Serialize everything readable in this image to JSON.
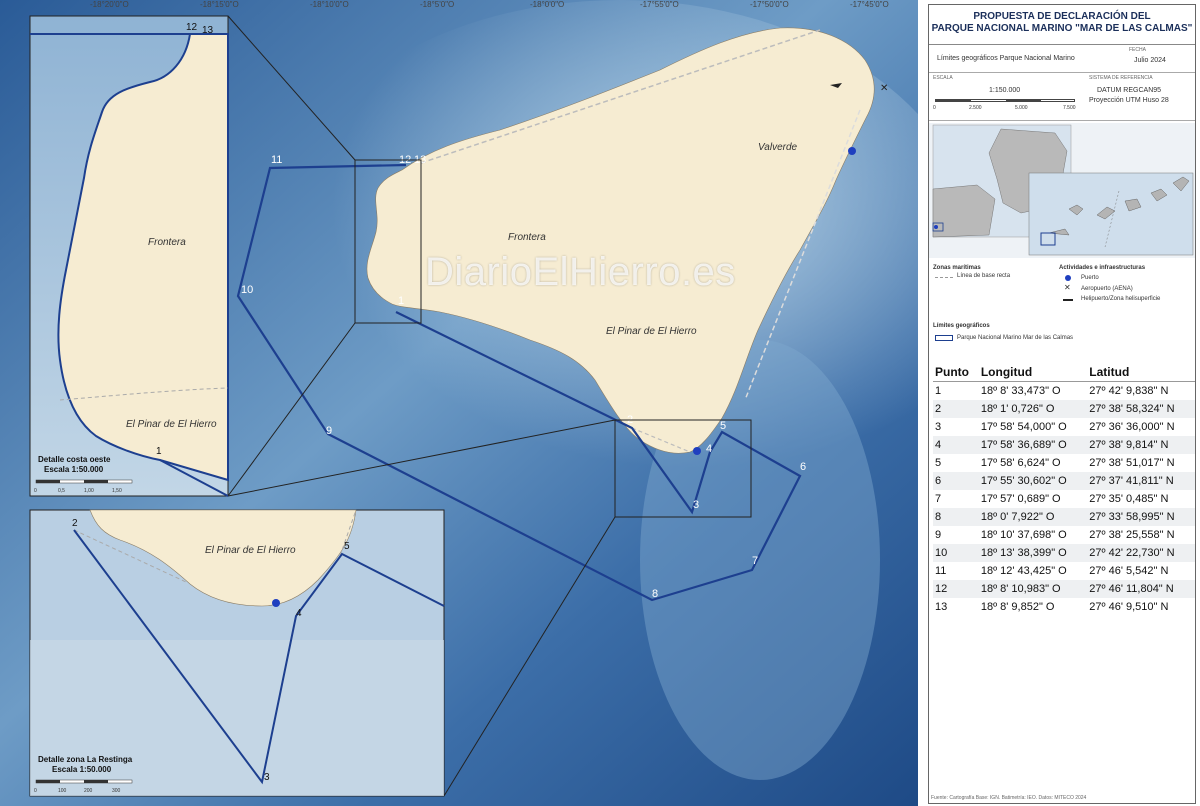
{
  "map": {
    "places": {
      "valverde": "Valverde",
      "frontera": "Frontera",
      "el_pinar": "El Pinar de El Hierro"
    },
    "points": [
      "1",
      "2",
      "3",
      "4",
      "5",
      "6",
      "7",
      "8",
      "9",
      "10",
      "11",
      "12",
      "13"
    ],
    "inset_left": {
      "place_frontera": "Frontera",
      "place_el_pinar": "El Pinar de El Hierro",
      "caption_line1": "Detalle costa oeste",
      "caption_line2": "Escala 1:50.000",
      "scale_labels": [
        "0",
        "0,5",
        "1,00",
        "1,50"
      ]
    },
    "inset_bottom": {
      "place_el_pinar": "El Pinar de El Hierro",
      "caption_line1": "Detalle zona La Restinga",
      "caption_line2": "Escala 1:50.000",
      "scale_labels": [
        "0",
        "100",
        "200",
        "300"
      ]
    },
    "watermark": "DiarioElHierro.es",
    "top_ticks": [
      "-18°20'0\"O",
      "-18°15'0\"O",
      "-18°10'0\"O",
      "-18°5'0\"O",
      "-18°0'0\"O",
      "-17°55'0\"O",
      "-17°50'0\"O",
      "-17°45'0\"O"
    ]
  },
  "panel": {
    "title_line1": "PROPUESTA DE DECLARACIÓN DEL",
    "title_line2": "PARQUE NACIONAL MARINO \"MAR DE LAS CALMAS\"",
    "subtitle": "Límites geográficos Parque Nacional Marino",
    "date_label": "FECHA",
    "date": "Julio 2024",
    "scale_label": "ESCALA",
    "scale": "1:150.000",
    "scale_ticks": [
      "0",
      "2.500",
      "5.000",
      "7.500"
    ],
    "datum_label": "SISTEMA DE REFERENCIA",
    "datum": "DATUM REGCAN95",
    "projection": "Proyección UTM Huso 28",
    "legend": {
      "zonas_title": "Zonas marítimas",
      "baseline": "Línea de base recta",
      "actividades_title": "Actividades e infraestructuras",
      "puerto": "Puerto",
      "aeropuerto": "Aeropuerto (AENA)",
      "helipuerto": "Helipuerto/Zona helisuperficie",
      "limites_title": "Límites geográficos",
      "parque": "Parque Nacional Marino Mar de las Calmas"
    },
    "table": {
      "headers": [
        "Punto",
        "Longitud",
        "Latitud"
      ],
      "rows": [
        [
          "1",
          "18º 8' 33,473\" O",
          "27º 42' 9,838\" N"
        ],
        [
          "2",
          "18º 1' 0,726\" O",
          "27º 38' 58,324\" N"
        ],
        [
          "3",
          "17º 58' 54,000\" O",
          "27º 36' 36,000\" N"
        ],
        [
          "4",
          "17º 58' 36,689\" O",
          "27º 38' 9,814\" N"
        ],
        [
          "5",
          "17º 58' 6,624\" O",
          "27º 38' 51,017\" N"
        ],
        [
          "6",
          "17º 55' 30,602\" O",
          "27º 37' 41,811\" N"
        ],
        [
          "7",
          "17º 57' 0,689\" O",
          "27º 35' 0,485\" N"
        ],
        [
          "8",
          "18º 0' 7,922\" O",
          "27º 33' 58,995\" N"
        ],
        [
          "9",
          "18º 10' 37,698\" O",
          "27º 38' 25,558\" N"
        ],
        [
          "10",
          "18º 13' 38,399\" O",
          "27º 42' 22,730\" N"
        ],
        [
          "11",
          "18º 12' 43,425\" O",
          "27º 46' 5,542\" N"
        ],
        [
          "12",
          "18º 8' 10,983\" O",
          "27º 46' 11,804\" N"
        ],
        [
          "13",
          "18º 8' 9,852\" O",
          "27º 46' 9,510\" N"
        ]
      ]
    },
    "footnote": "Fuente: Cartografía Base: IGN. Batimetría: IEO. Datos: MITECO 2024"
  },
  "colors": {
    "sea_deep": "#1f4e8c",
    "sea_shallow": "#8fb9d8",
    "land": "#f6ecd2",
    "boundary": "#1d3f8f"
  }
}
